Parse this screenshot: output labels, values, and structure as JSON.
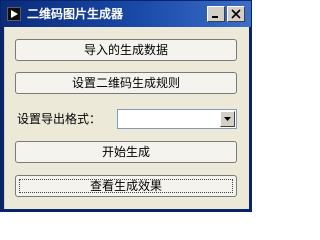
{
  "window": {
    "title": "二维码图片生成器",
    "controls": {
      "minimize_icon": "minimize-icon",
      "close_icon": "close-icon"
    }
  },
  "buttons": {
    "import_data": "导入的生成数据",
    "set_rules": "设置二维码生成规则",
    "start": "开始生成",
    "view_result": "查看生成效果"
  },
  "export_format": {
    "label": "设置导出格式：",
    "selected": ""
  },
  "colors": {
    "titlebar_start": "#0b2a7a",
    "titlebar_end": "#3a6ec8",
    "client_bg": "#ece9d8"
  }
}
